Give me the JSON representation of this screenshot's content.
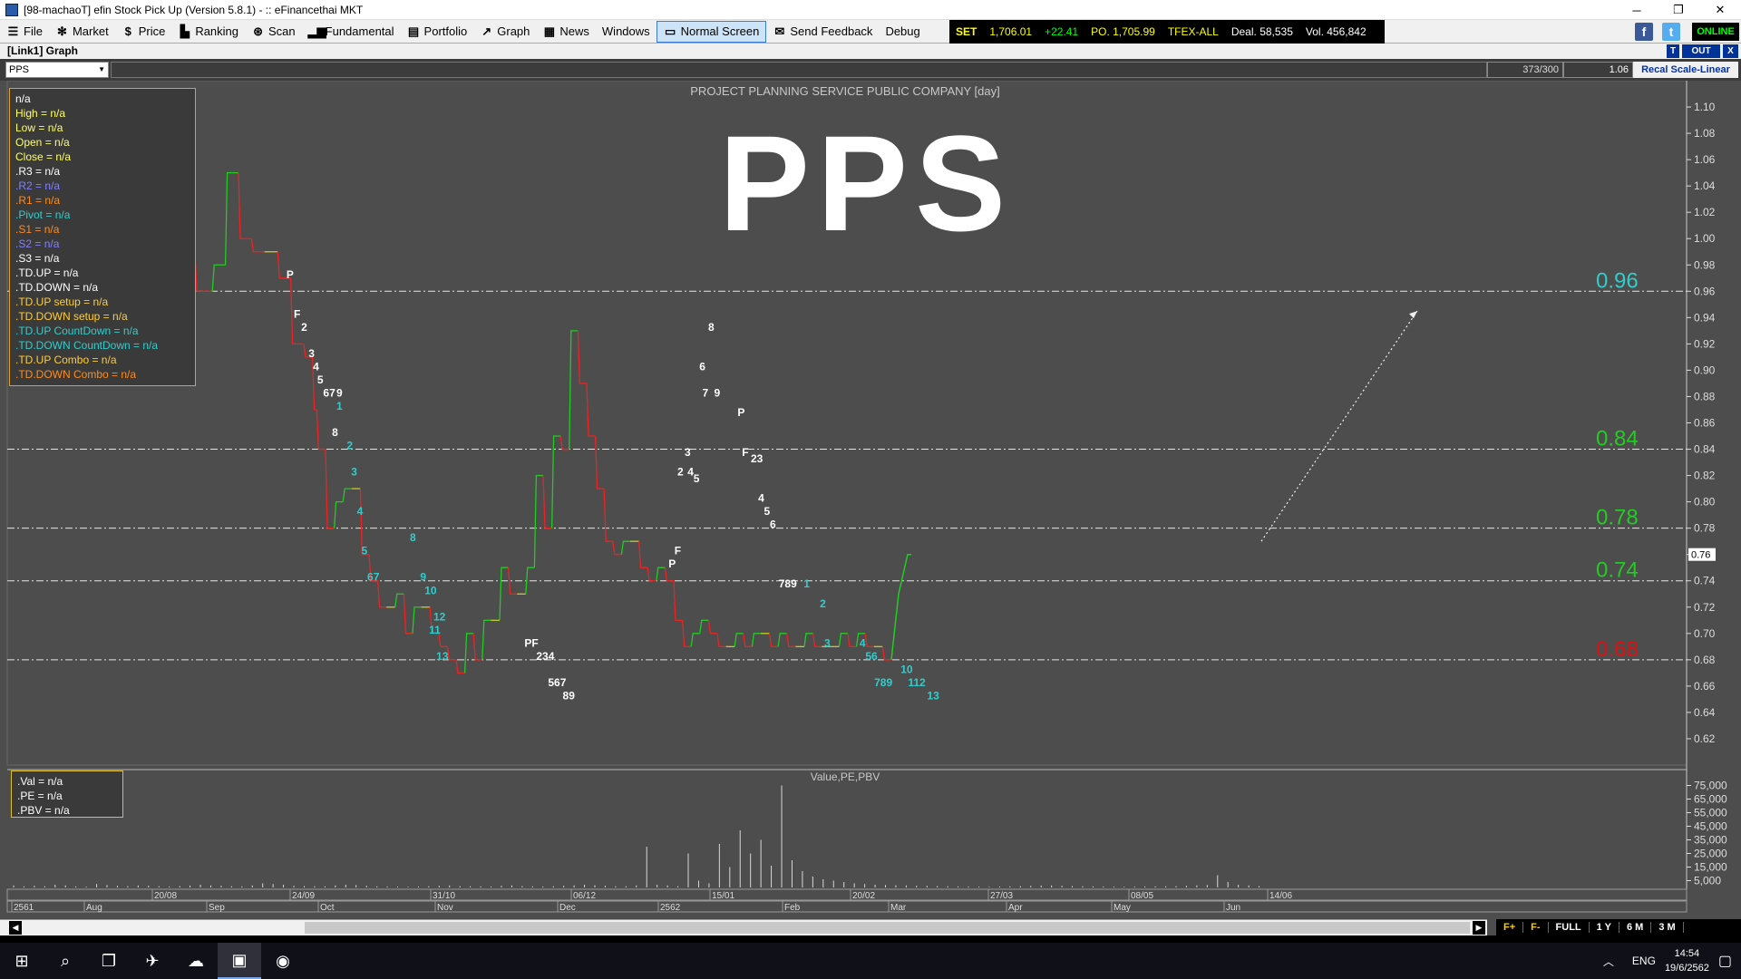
{
  "window": {
    "title": "[98-machaoT] efin Stock Pick Up (Version 5.8.1) - :: eFinancethai MKT",
    "controls": [
      "─",
      "❐",
      "✕"
    ]
  },
  "menu": [
    {
      "label": "File",
      "icon": "☰",
      "name": "file"
    },
    {
      "label": "Market",
      "icon": "✻",
      "name": "market"
    },
    {
      "label": "Price",
      "icon": "$",
      "name": "price"
    },
    {
      "label": "Ranking",
      "icon": "▙",
      "name": "ranking"
    },
    {
      "label": "Scan",
      "icon": "⊛",
      "name": "scan"
    },
    {
      "label": "Fundamental",
      "icon": "▂▆",
      "name": "fundamental"
    },
    {
      "label": "Portfolio",
      "icon": "▤",
      "name": "portfolio"
    },
    {
      "label": "Graph",
      "icon": "↗",
      "name": "graph"
    },
    {
      "label": "News",
      "icon": "▦",
      "name": "news"
    },
    {
      "label": "Windows",
      "icon": "",
      "name": "windows"
    },
    {
      "label": "Normal Screen",
      "icon": "▭",
      "name": "normal-screen",
      "active": true
    },
    {
      "label": "Send Feedback",
      "icon": "✉",
      "name": "send-feedback"
    },
    {
      "label": "Debug",
      "icon": "",
      "name": "debug"
    }
  ],
  "ticker": {
    "set_label": "SET",
    "set_value": "1,706.01",
    "set_change": "+22.41",
    "po": "PO. 1,705.99",
    "tfex": "TFEX-ALL",
    "deal": "Deal. 58,535",
    "vol": "Vol. 456,842"
  },
  "status": {
    "online": "ONLINE"
  },
  "link": {
    "title": "[Link1] Graph",
    "buttons": [
      "T",
      "OUT",
      "X"
    ]
  },
  "symbar": {
    "symbol": "PPS",
    "count": "373/300",
    "ratio": "1.06",
    "recal": "Recal Scale-Linear"
  },
  "info": [
    {
      "text": "n/a",
      "color": "#ffffff"
    },
    {
      "text": "High  = n/a",
      "color": "#ffff66"
    },
    {
      "text": "Low  = n/a",
      "color": "#ffff66"
    },
    {
      "text": "Open  = n/a",
      "color": "#ffff66"
    },
    {
      "text": "Close  = n/a",
      "color": "#ffff66"
    },
    {
      "text": ".R3    = n/a",
      "color": "#ffffff"
    },
    {
      "text": ".R2    = n/a",
      "color": "#8080ff"
    },
    {
      "text": ".R1    = n/a",
      "color": "#ff8c1a"
    },
    {
      "text": ".Pivot    = n/a",
      "color": "#33cccc"
    },
    {
      "text": ".S1    = n/a",
      "color": "#ff8c1a"
    },
    {
      "text": ".S2    = n/a",
      "color": "#8080ff"
    },
    {
      "text": ".S3    = n/a",
      "color": "#ffffff"
    },
    {
      "text": ".TD.UP    = n/a",
      "color": "#ffffff"
    },
    {
      "text": ".TD.DOWN    = n/a",
      "color": "#ffffff"
    },
    {
      "text": ".TD.UP setup    = n/a",
      "color": "#ffcc33"
    },
    {
      "text": ".TD.DOWN setup    = n/a",
      "color": "#ffcc33"
    },
    {
      "text": ".TD.UP CountDown    = n/a",
      "color": "#33cccc"
    },
    {
      "text": ".TD.DOWN CountDown    = n/a",
      "color": "#33cccc"
    },
    {
      "text": ".TD.UP Combo    = n/a",
      "color": "#ffcc33"
    },
    {
      "text": ".TD.DOWN Combo    = n/a",
      "color": "#ff8c1a"
    }
  ],
  "valinfo": [
    ".Val    = n/a",
    ".PE    = n/a",
    ".PBV    = n/a"
  ],
  "timeframes": [
    "F+",
    "F-",
    "FULL",
    "1 Y",
    "6 M",
    "3 M"
  ],
  "taskbar": {
    "lang": "ENG",
    "time": "14:54",
    "date": "19/6/2562",
    "tray_arrow": "︿",
    "items": [
      {
        "name": "start",
        "glyph": "⊞"
      },
      {
        "name": "search",
        "glyph": "⌕"
      },
      {
        "name": "task-view",
        "glyph": "❐"
      },
      {
        "name": "app-satellite",
        "glyph": "✈"
      },
      {
        "name": "app-cloud",
        "glyph": "☁"
      },
      {
        "name": "app-efin",
        "glyph": "▣"
      },
      {
        "name": "app-chrome",
        "glyph": "◉"
      }
    ],
    "notification_glyph": "▢"
  },
  "chart_data": {
    "type": "line",
    "title": "PROJECT PLANNING SERVICE PUBLIC COMPANY [day]",
    "watermark": "PPS",
    "lower_title": "Value,PE,PBV",
    "ylim": [
      0.6,
      1.12
    ],
    "yticks": [
      1.1,
      1.08,
      1.06,
      1.04,
      1.02,
      1.0,
      0.98,
      0.96,
      0.94,
      0.92,
      0.9,
      0.88,
      0.86,
      0.84,
      0.82,
      0.8,
      0.78,
      0.76,
      0.74,
      0.72,
      0.7,
      0.68,
      0.66,
      0.64,
      0.62
    ],
    "last_price": "0.76",
    "x": [
      0,
      4,
      7,
      10,
      13,
      16,
      19,
      22,
      25,
      27,
      28,
      30,
      32,
      34,
      36,
      38,
      40,
      42,
      44,
      46,
      48,
      50,
      52,
      54,
      56,
      58,
      60,
      62,
      64,
      66,
      68,
      70,
      72,
      74,
      76,
      78,
      80,
      82,
      84,
      86,
      88,
      90,
      92,
      94,
      96,
      98,
      100,
      102,
      104,
      106,
      108,
      110,
      112,
      114,
      116,
      118,
      120,
      122,
      124,
      126,
      128,
      130,
      132,
      134,
      136,
      138,
      140,
      142,
      144,
      146,
      148,
      150,
      152,
      154,
      156,
      158,
      160,
      162,
      164,
      166,
      168,
      170,
      172,
      174,
      176,
      178,
      180,
      182,
      184,
      186,
      188,
      190,
      192,
      194,
      196,
      198,
      200,
      202,
      204,
      206,
      208,
      210,
      212,
      214,
      216,
      218,
      220,
      222,
      224,
      226,
      228,
      230,
      232,
      234,
      236,
      238,
      240,
      242,
      244,
      246,
      248,
      250
    ],
    "price": [
      0.99,
      0.96,
      0.98,
      1.05,
      1.0,
      0.99,
      0.99,
      0.97,
      0.92,
      0.91,
      0.87,
      0.84,
      0.78,
      0.8,
      0.81,
      0.81,
      0.76,
      0.74,
      0.72,
      0.72,
      0.73,
      0.7,
      0.72,
      0.72,
      0.7,
      0.69,
      0.68,
      0.67,
      0.7,
      0.68,
      0.71,
      0.71,
      0.75,
      0.73,
      0.73,
      0.75,
      0.82,
      0.78,
      0.85,
      0.84,
      0.93,
      0.89,
      0.85,
      0.81,
      0.77,
      0.76,
      0.77,
      0.77,
      0.75,
      0.74,
      0.75,
      0.74,
      0.71,
      0.69,
      0.7,
      0.71,
      0.7,
      0.69,
      0.69,
      0.7,
      0.69,
      0.7,
      0.7,
      0.69,
      0.7,
      0.69,
      0.69,
      0.7,
      0.69,
      0.69,
      0.69,
      0.7,
      0.69,
      0.7,
      0.69,
      0.69,
      0.68,
      0.73,
      0.76,
      0.76,
      0.76,
      0.76,
      0.76,
      0.76,
      0.76,
      0.76,
      0.76,
      0.76,
      0.76,
      0.76,
      0.76,
      0.76,
      0.76,
      0.76,
      0.76,
      0.76,
      0.76,
      0.76,
      0.76,
      0.76,
      0.76,
      0.76,
      0.76,
      0.76,
      0.76,
      0.76,
      0.76,
      0.76,
      0.76,
      0.76,
      0.76,
      0.76,
      0.76,
      0.76,
      0.76,
      0.76,
      0.76,
      0.76,
      0.76,
      0.76
    ],
    "levels": [
      {
        "value": 0.96,
        "label": "0.96",
        "color": "#33cccc"
      },
      {
        "value": 0.84,
        "label": "0.84",
        "color": "#22cc22"
      },
      {
        "value": 0.78,
        "label": "0.78",
        "color": "#22cc22"
      },
      {
        "value": 0.74,
        "label": "0.74",
        "color": "#22cc22"
      },
      {
        "value": 0.68,
        "label": "0.68",
        "color": "#dd1111"
      }
    ],
    "td_labels": [
      {
        "t": "P",
        "x": 0.19,
        "y": 0.97,
        "c": "#ffffff"
      },
      {
        "t": "F",
        "x": 0.195,
        "y": 0.94,
        "c": "#ffffff"
      },
      {
        "t": "2",
        "x": 0.2,
        "y": 0.93,
        "c": "#ffffff"
      },
      {
        "t": "3",
        "x": 0.205,
        "y": 0.91,
        "c": "#ffffff"
      },
      {
        "t": "4",
        "x": 0.208,
        "y": 0.9,
        "c": "#ffffff"
      },
      {
        "t": "5",
        "x": 0.211,
        "y": 0.89,
        "c": "#ffffff"
      },
      {
        "t": "67",
        "x": 0.215,
        "y": 0.88,
        "c": "#ffffff"
      },
      {
        "t": "9",
        "x": 0.224,
        "y": 0.88,
        "c": "#ffffff"
      },
      {
        "t": "1",
        "x": 0.224,
        "y": 0.87,
        "c": "#33cccc"
      },
      {
        "t": "8",
        "x": 0.221,
        "y": 0.85,
        "c": "#ffffff"
      },
      {
        "t": "2",
        "x": 0.231,
        "y": 0.84,
        "c": "#33cccc"
      },
      {
        "t": "3",
        "x": 0.234,
        "y": 0.82,
        "c": "#33cccc"
      },
      {
        "t": "4",
        "x": 0.238,
        "y": 0.79,
        "c": "#33cccc"
      },
      {
        "t": "5",
        "x": 0.241,
        "y": 0.76,
        "c": "#33cccc"
      },
      {
        "t": "67",
        "x": 0.245,
        "y": 0.74,
        "c": "#33cccc"
      },
      {
        "t": "8",
        "x": 0.274,
        "y": 0.77,
        "c": "#33cccc"
      },
      {
        "t": "9",
        "x": 0.281,
        "y": 0.74,
        "c": "#33cccc"
      },
      {
        "t": "10",
        "x": 0.284,
        "y": 0.73,
        "c": "#33cccc"
      },
      {
        "t": "12",
        "x": 0.29,
        "y": 0.71,
        "c": "#33cccc"
      },
      {
        "t": "11",
        "x": 0.287,
        "y": 0.7,
        "c": "#33cccc"
      },
      {
        "t": "13",
        "x": 0.292,
        "y": 0.68,
        "c": "#33cccc"
      },
      {
        "t": "PF",
        "x": 0.352,
        "y": 0.69,
        "c": "#ffffff"
      },
      {
        "t": "234",
        "x": 0.36,
        "y": 0.68,
        "c": "#ffffff"
      },
      {
        "t": "567",
        "x": 0.368,
        "y": 0.66,
        "c": "#ffffff"
      },
      {
        "t": "89",
        "x": 0.378,
        "y": 0.65,
        "c": "#ffffff"
      },
      {
        "t": "P",
        "x": 0.45,
        "y": 0.75,
        "c": "#ffffff"
      },
      {
        "t": "F",
        "x": 0.454,
        "y": 0.76,
        "c": "#ffffff"
      },
      {
        "t": "2",
        "x": 0.456,
        "y": 0.82,
        "c": "#ffffff"
      },
      {
        "t": "4",
        "x": 0.463,
        "y": 0.82,
        "c": "#ffffff"
      },
      {
        "t": "5",
        "x": 0.467,
        "y": 0.815,
        "c": "#ffffff"
      },
      {
        "t": "3",
        "x": 0.461,
        "y": 0.835,
        "c": "#ffffff"
      },
      {
        "t": "7",
        "x": 0.473,
        "y": 0.88,
        "c": "#ffffff"
      },
      {
        "t": "9",
        "x": 0.481,
        "y": 0.88,
        "c": "#ffffff"
      },
      {
        "t": "6",
        "x": 0.471,
        "y": 0.9,
        "c": "#ffffff"
      },
      {
        "t": "8",
        "x": 0.477,
        "y": 0.93,
        "c": "#ffffff"
      },
      {
        "t": "P",
        "x": 0.497,
        "y": 0.865,
        "c": "#ffffff"
      },
      {
        "t": "F",
        "x": 0.5,
        "y": 0.835,
        "c": "#ffffff"
      },
      {
        "t": "23",
        "x": 0.506,
        "y": 0.83,
        "c": "#ffffff"
      },
      {
        "t": "4",
        "x": 0.511,
        "y": 0.8,
        "c": "#ffffff"
      },
      {
        "t": "5",
        "x": 0.515,
        "y": 0.79,
        "c": "#ffffff"
      },
      {
        "t": "6",
        "x": 0.519,
        "y": 0.78,
        "c": "#ffffff"
      },
      {
        "t": "789",
        "x": 0.525,
        "y": 0.735,
        "c": "#ffffff"
      },
      {
        "t": "1",
        "x": 0.542,
        "y": 0.735,
        "c": "#33cccc"
      },
      {
        "t": "2",
        "x": 0.553,
        "y": 0.72,
        "c": "#33cccc"
      },
      {
        "t": "3",
        "x": 0.556,
        "y": 0.69,
        "c": "#33cccc"
      },
      {
        "t": "4",
        "x": 0.58,
        "y": 0.69,
        "c": "#33cccc"
      },
      {
        "t": "56",
        "x": 0.584,
        "y": 0.68,
        "c": "#33cccc"
      },
      {
        "t": "10",
        "x": 0.608,
        "y": 0.67,
        "c": "#33cccc"
      },
      {
        "t": "789",
        "x": 0.59,
        "y": 0.66,
        "c": "#33cccc"
      },
      {
        "t": "112",
        "x": 0.613,
        "y": 0.66,
        "c": "#33cccc"
      },
      {
        "t": "13",
        "x": 0.626,
        "y": 0.65,
        "c": "#33cccc"
      }
    ],
    "x_dates_top": [
      "20/08",
      "24/09",
      "31/10",
      "06/12",
      "15/01",
      "20/02",
      "27/03",
      "08/05",
      "14/06"
    ],
    "x_months": [
      "2561",
      "Aug",
      "Sep",
      "Oct",
      "Nov",
      "Dec",
      "2562",
      "Feb",
      "Mar",
      "Apr",
      "May",
      "Jun"
    ],
    "volume_yticks": [
      "75,000",
      "65,000",
      "55,000",
      "45,000",
      "35,000",
      "25,000",
      "15,000",
      "5,000"
    ],
    "volume_ylim": [
      0,
      80000
    ],
    "volume": [
      1500,
      800,
      1200,
      900,
      2000,
      1500,
      800,
      600,
      2500,
      1800,
      1200,
      1000,
      1500,
      1300,
      900,
      700,
      1000,
      1400,
      2000,
      1500,
      1200,
      900,
      800,
      1500,
      3000,
      2500,
      2000,
      1200,
      1000,
      900,
      800,
      1500,
      2000,
      1800,
      1200,
      800,
      700,
      600,
      500,
      700,
      900,
      1200,
      1500,
      1000,
      900,
      800,
      700,
      1200,
      1500,
      1000,
      800,
      700,
      900,
      1200,
      1500,
      2000,
      1600,
      1200,
      800,
      900,
      1500,
      30000,
      2000,
      1500,
      900,
      25000,
      5000,
      3000,
      32000,
      15000,
      42000,
      25000,
      35000,
      16000,
      75000,
      20000,
      12000,
      8000,
      6000,
      5000,
      4000,
      3000,
      2500,
      2000,
      1800,
      1600,
      1500,
      1300,
      1200,
      1000,
      900,
      800,
      700,
      600,
      500,
      600,
      800,
      1000,
      1200,
      1400,
      1500,
      1200,
      1000,
      900,
      800,
      700,
      600,
      500,
      600,
      700,
      800,
      900,
      1000,
      1200,
      1500,
      1800,
      9000,
      4000,
      2000,
      1500,
      1000
    ]
  }
}
